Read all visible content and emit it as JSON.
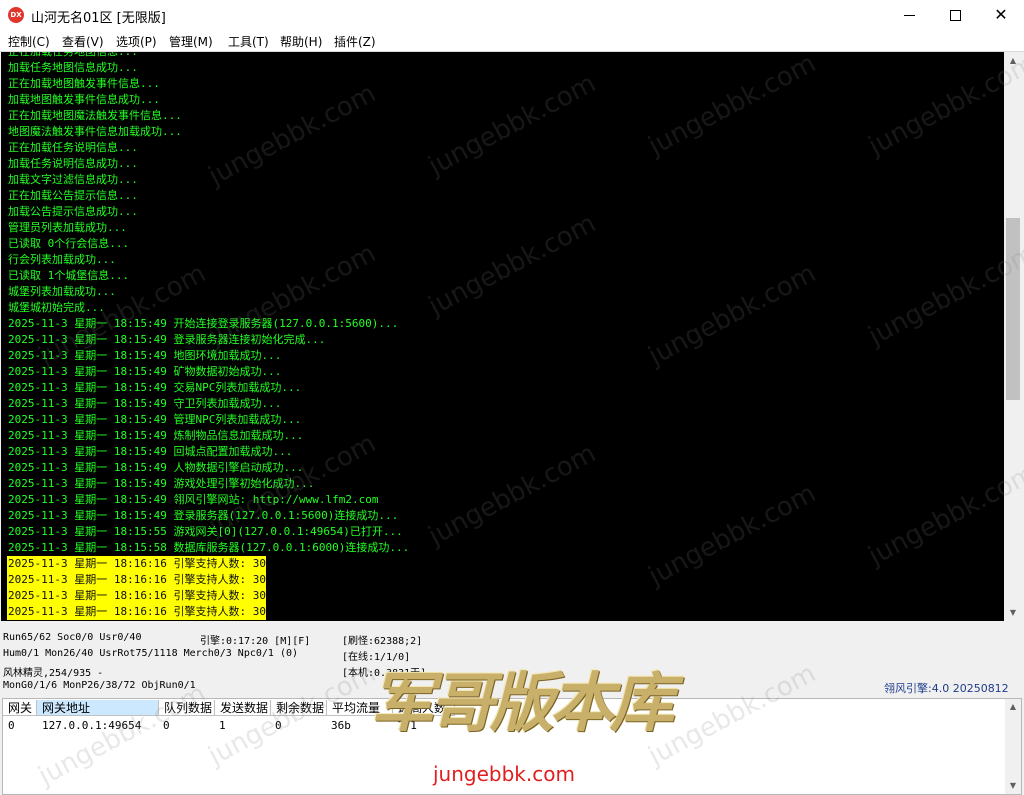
{
  "window": {
    "title": "山河无名01区 [无限版]",
    "icon_text": "DX"
  },
  "menu": [
    "控制(C)",
    "查看(V)",
    "选项(P)",
    "管理(M)",
    "工具(T)",
    "帮助(H)",
    "插件(Z)"
  ],
  "console": {
    "lines": [
      "正在加载任务地图信息...",
      "加载任务地图信息成功...",
      "正在加载地图触发事件信息...",
      "加载地图触发事件信息成功...",
      "正在加载地图魔法触发事件信息...",
      "地图魔法触发事件信息加载成功...",
      "正在加载任务说明信息...",
      "加载任务说明信息成功...",
      "加载文字过滤信息成功...",
      "正在加载公告提示信息...",
      "加载公告提示信息成功...",
      "管理员列表加载成功...",
      "已读取 0个行会信息...",
      "行会列表加载成功...",
      "已读取 1个城堡信息...",
      "城堡列表加载成功...",
      "城堡城初始完成...",
      "2025-11-3 星期一 18:15:49 开始连接登录服务器(127.0.0.1:5600)...",
      "2025-11-3 星期一 18:15:49 登录服务器连接初始化完成...",
      "2025-11-3 星期一 18:15:49 地图环境加载成功...",
      "2025-11-3 星期一 18:15:49 矿物数据初始成功...",
      "2025-11-3 星期一 18:15:49 交易NPC列表加载成功...",
      "2025-11-3 星期一 18:15:49 守卫列表加载成功...",
      "2025-11-3 星期一 18:15:49 管理NPC列表加载成功...",
      "2025-11-3 星期一 18:15:49 炼制物品信息加载成功...",
      "2025-11-3 星期一 18:15:49 回城点配置加载成功...",
      "2025-11-3 星期一 18:15:49 人物数据引擎启动成功...",
      "2025-11-3 星期一 18:15:49 游戏处理引擎初始化成功...",
      "2025-11-3 星期一 18:15:49 翎风引擎网站: http://www.lfm2.com",
      "2025-11-3 星期一 18:15:49 登录服务器(127.0.0.1:5600)连接成功...",
      "2025-11-3 星期一 18:15:55 游戏网关[0](127.0.0.1:49654)已打开...",
      "2025-11-3 星期一 18:15:58 数据库服务器(127.0.0.1:6000)连接成功..."
    ],
    "highlight_lines": [
      "2025-11-3 星期一 18:16:16 引擎支持人数: 30",
      "2025-11-3 星期一 18:16:16 引擎支持人数: 30",
      "2025-11-3 星期一 18:16:16 引擎支持人数: 30",
      "2025-11-3 星期一 18:16:16 引擎支持人数: 30"
    ],
    "text_color": "#22ff22",
    "highlight_color": "#ffff00"
  },
  "status": {
    "run": "Run65/62 Soc0/0 Usr0/40",
    "engine_time": "引擎:0:17:20 [M][F]",
    "refresh": "[刷怪:62388;2]",
    "hum": "Hum0/1 Mon26/40 UsrRot75/1118 Merch0/3 Npc0/1 (0)",
    "online": "[在线:1/1/0]",
    "elf": "风林精灵,254/935 -",
    "local": "[本机:0.3831天]",
    "mon": "MonG0/1/6 MonP26/38/72 ObjRun0/1",
    "engine_version": "翎风引擎:4.0 20250812"
  },
  "gateway_table": {
    "headers": [
      "网关",
      "网关地址",
      "队列数据",
      "发送数据",
      "剩余数据",
      "平均流量",
      "最高人数"
    ],
    "rows": [
      [
        "0",
        "127.0.0.1:49654",
        "0",
        "1",
        "0",
        "36b",
        "1/1"
      ]
    ]
  },
  "watermark": {
    "text": "jungebbk.com",
    "logo": "军哥版本库"
  }
}
